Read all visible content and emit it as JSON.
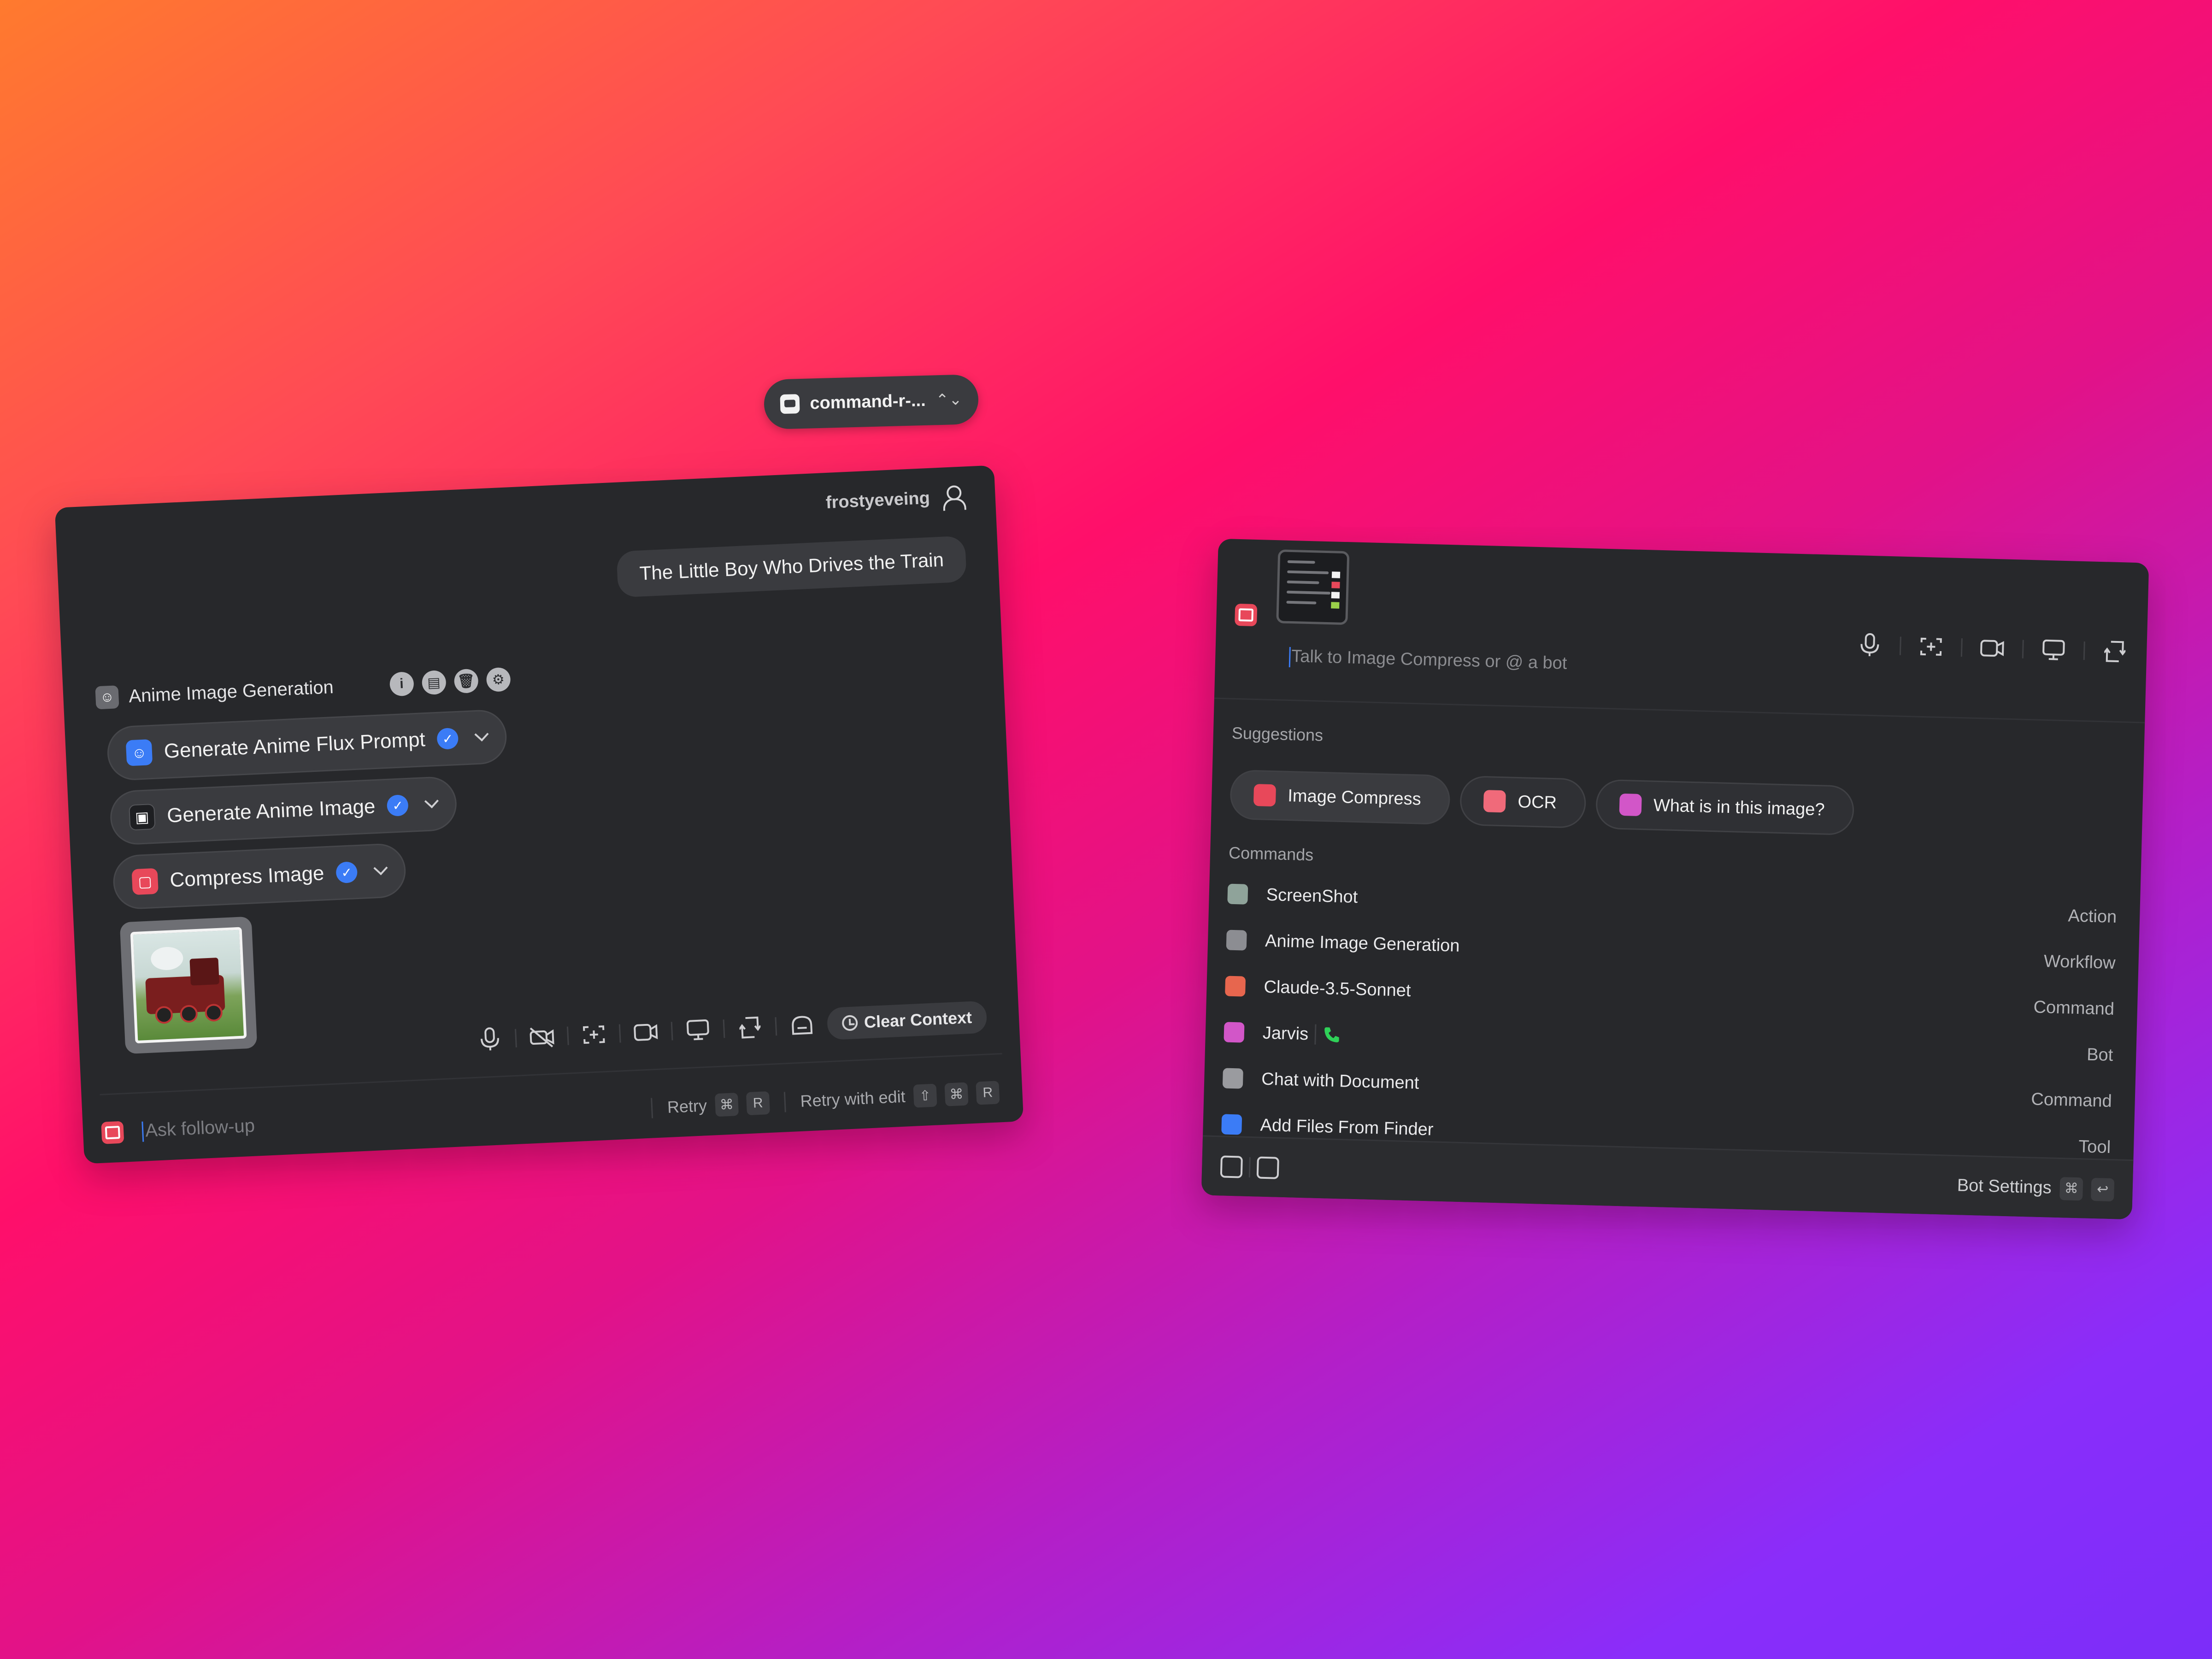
{
  "colors": {
    "panel_bg": "#27282b",
    "chip_bg": "#3a3b3f",
    "accent_blue": "#3b7cf6",
    "call_green": "#2fd158"
  },
  "model_selector": {
    "label": "command-r-...",
    "icon": "model-logo-icon",
    "chevron": "⌃⌄"
  },
  "left_panel": {
    "username": "frostyeveing",
    "user_message": "The Little Boy Who Drives the Train",
    "workflow": {
      "title": "Anime Image Generation",
      "tool_icons": [
        "info-icon",
        "document-icon",
        "trash-icon",
        "settings-icon"
      ],
      "tool_glyphs": [
        "i",
        "▤",
        "🗑",
        "⚙"
      ],
      "steps": [
        {
          "label": "Generate Anime Flux Prompt",
          "icon": "robot-icon",
          "icon_color": "#3b7cf6",
          "done": true
        },
        {
          "label": "Generate Anime Image",
          "icon": "image-gen-icon",
          "icon_color": "#1e1f22",
          "done": true
        },
        {
          "label": "Compress  Image",
          "icon": "compress-icon",
          "icon_color": "#e8485a",
          "done": true
        }
      ],
      "check_glyph": "✓"
    },
    "result_image": "generated-train-image",
    "toolbar": {
      "icons": [
        "microphone-icon",
        "camera-off-icon",
        "screenshot-icon",
        "video-icon",
        "monitor-icon",
        "app-switch-icon",
        "bot-icon"
      ],
      "clear_label": "Clear Context"
    },
    "composer": {
      "placeholder": "Ask follow-up",
      "retry_label": "Retry",
      "retry_keys": [
        "⌘",
        "R"
      ],
      "retry_edit_label": "Retry with edit",
      "retry_edit_keys": [
        "⇧",
        "⌘",
        "R"
      ]
    }
  },
  "right_panel": {
    "input_placeholder": "Talk to Image Compress or @ a bot",
    "toolbar_icons": [
      "microphone-icon",
      "screenshot-icon",
      "video-icon",
      "monitor-icon",
      "app-switch-icon"
    ],
    "suggestions_label": "Suggestions",
    "suggestions": [
      {
        "label": "Image Compress",
        "icon_color": "#e8485a"
      },
      {
        "label": "OCR",
        "icon_color": "#f06a7a"
      },
      {
        "label": "What is in this image?",
        "icon_color": "#d256c8"
      }
    ],
    "commands_label": "Commands",
    "commands": [
      {
        "label": "ScreenShot",
        "type": "Action",
        "icon_color": "#8fa39a"
      },
      {
        "label": "Anime Image Generation",
        "type": "Workflow",
        "icon_color": "#8c8d92"
      },
      {
        "label": "Claude-3.5-Sonnet",
        "type": "Command",
        "icon_color": "#e7664e"
      },
      {
        "label": "Jarvis",
        "type": "Bot",
        "icon_color": "#d256c8"
      },
      {
        "label": "Chat with Document",
        "type": "Command",
        "icon_color": "#9a9b9f"
      },
      {
        "label": "Add Files From Finder",
        "type": "Tool",
        "icon_color": "#3b7cf6"
      }
    ],
    "footer": {
      "bot_settings_label": "Bot Settings",
      "keys": [
        "⌘",
        "↩"
      ]
    }
  }
}
